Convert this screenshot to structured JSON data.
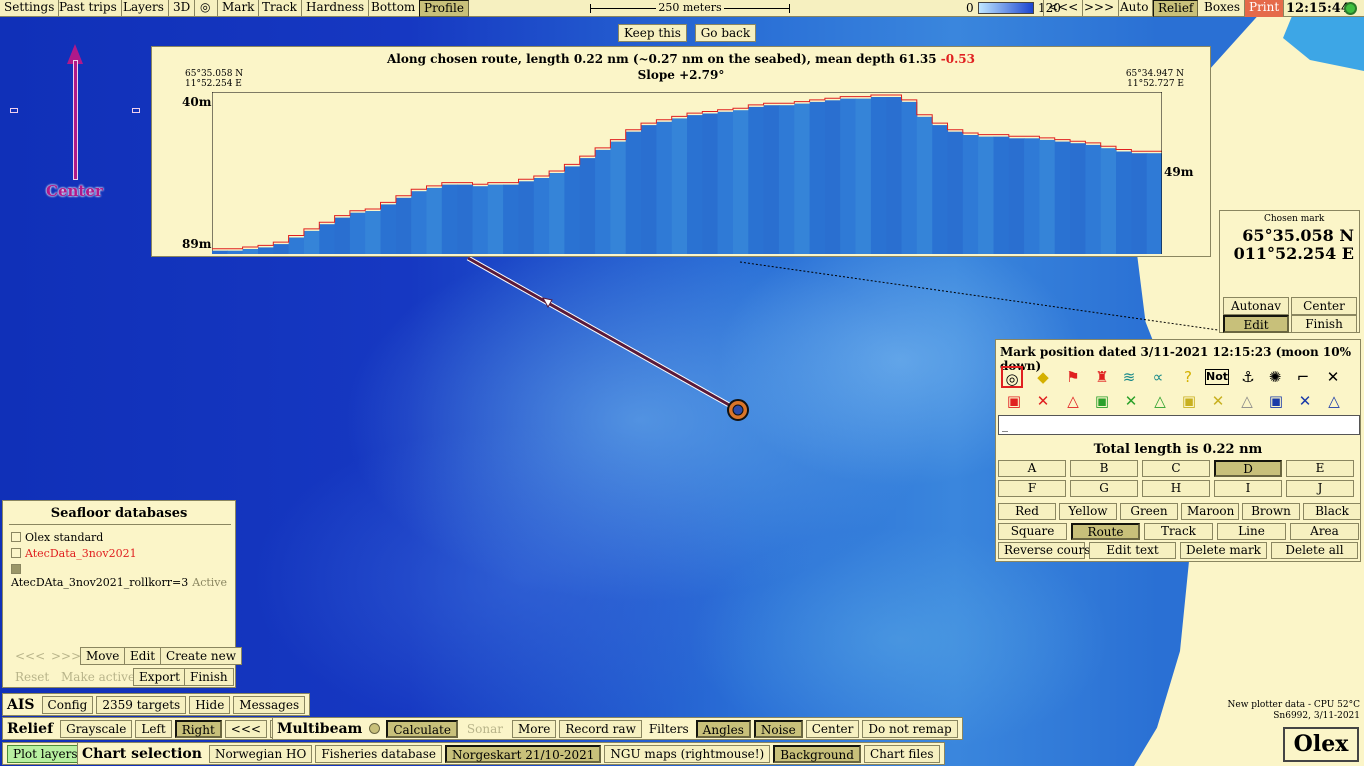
{
  "toolbar": {
    "settings": "Settings",
    "past_trips": "Past trips",
    "layers": "Layers",
    "three_d": "3D",
    "mark": "Mark",
    "track": "Track",
    "hardness": "Hardness",
    "bottom": "Bottom",
    "profile": "Profile",
    "scale_label": "250 meters",
    "depth_min": "0",
    "depth_max": "120",
    "prev": "<<<",
    "next": ">>>",
    "auto": "Auto",
    "relief": "Relief",
    "boxes": "Boxes",
    "print": "Print",
    "clock": "12:15:44"
  },
  "keep_this": "Keep this",
  "go_back": "Go back",
  "north_label": "Center",
  "profile": {
    "title_main": "Along chosen route, length 0.22 nm (~0.27 nm on the seabed), mean depth 61.35",
    "title_neg": "-0.53",
    "slope": "Slope +2.79°",
    "start_lat": "65°35.058 N",
    "start_lon": "11°52.254 E",
    "end_lat": "65°34.947 N",
    "end_lon": "11°52.727 E",
    "y_top": "40m",
    "y_bottom": "89m",
    "y_right": "49m"
  },
  "chart_data": {
    "type": "area",
    "title": "Along chosen route, length 0.22 nm (~0.27 nm on the seabed), mean depth 61.35 -0.53",
    "ylim": [
      40,
      89
    ],
    "y_inverted": true,
    "x_label": "",
    "y_label": "",
    "series": [
      {
        "values": [
          88,
          88,
          87.5,
          87,
          86,
          84,
          82,
          80,
          78,
          76.5,
          76,
          74,
          72,
          70,
          69,
          68,
          68,
          68.5,
          68,
          68,
          67,
          66,
          64.5,
          62.5,
          60,
          57.5,
          55,
          52,
          50,
          49,
          48,
          47,
          46.5,
          46,
          45.5,
          44.5,
          44,
          44,
          43.5,
          43,
          42.5,
          42,
          42,
          41.5,
          41.5,
          43,
          47.5,
          50,
          52,
          53,
          53.5,
          53.5,
          54,
          54,
          54.5,
          55,
          55.5,
          56,
          57,
          58,
          58.5,
          58.5
        ]
      }
    ]
  },
  "chosen_mark": {
    "title": "Chosen mark",
    "lat": "65°35.058 N",
    "lon": "011°52.254 E",
    "autonav": "Autonav",
    "center": "Center",
    "edit": "Edit",
    "finish": "Finish"
  },
  "mark_panel": {
    "title": "Mark position dated 3/11-2021 12:15:23 (moon 10% down)",
    "not_label": "Not",
    "text_value": "_",
    "total_length": "Total length is 0.22 nm",
    "letters": [
      "A",
      "B",
      "C",
      "D",
      "E",
      "F",
      "G",
      "H",
      "I",
      "J"
    ],
    "colors": [
      "Red",
      "Yellow",
      "Green",
      "Maroon",
      "Brown",
      "Black"
    ],
    "types": [
      "Square",
      "Route",
      "Track",
      "Line",
      "Area"
    ],
    "actions": [
      "Reverse course",
      "Edit text",
      "Delete mark",
      "Delete all"
    ]
  },
  "seafloor": {
    "title": "Seafloor databases",
    "items": [
      {
        "label": "Olex standard"
      },
      {
        "label": "AtecData_3nov2021"
      },
      {
        "label": "AtecDAta_3nov2021_rollkorr=3",
        "status": "Active"
      }
    ],
    "prev": "<<<",
    "next": ">>>",
    "move": "Move",
    "edit": "Edit",
    "create_new": "Create new",
    "reset": "Reset",
    "make_active": "Make active",
    "export": "Export",
    "finish": "Finish"
  },
  "ais": {
    "label": "AIS",
    "config": "Config",
    "targets": "2359 targets",
    "hide": "Hide",
    "messages": "Messages"
  },
  "relief": {
    "label": "Relief",
    "grayscale": "Grayscale",
    "left": "Left",
    "right": "Right",
    "prev": "<<<",
    "next": ">>>"
  },
  "multibeam": {
    "label": "Multibeam",
    "calculate": "Calculate",
    "sonar": "Sonar",
    "more": "More",
    "record_raw": "Record raw",
    "filters": "Filters",
    "angles": "Angles",
    "noise": "Noise",
    "center": "Center",
    "do_not_remap": "Do not remap"
  },
  "plot_layers": "Plot layers",
  "chart_selection": {
    "label": "Chart selection",
    "norwegian_ho": "Norwegian HO",
    "fisheries": "Fisheries database",
    "norgeskart": "Norgeskart 21/10-2021",
    "ngu": "NGU maps (rightmouse!)",
    "background": "Background",
    "chart_files": "Chart files"
  },
  "status": {
    "line1": "New plotter data - CPU 52°C",
    "line2": "Sn6992, 3/11-2021"
  },
  "logo": "Olex",
  "colors": {
    "panel": "#fbf5c8",
    "button_on": "#c8c07a",
    "route": "#5a1a3a",
    "accent_red": "#e02020",
    "north_arrow": "#b0198a"
  }
}
